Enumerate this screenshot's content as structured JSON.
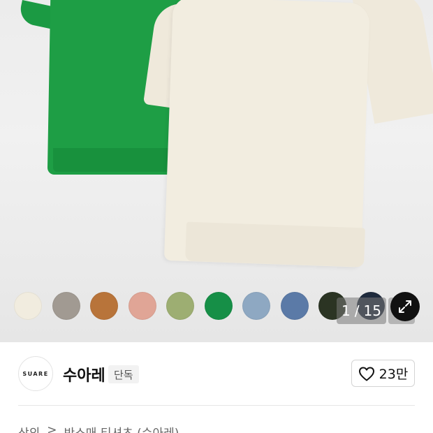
{
  "gallery": {
    "counter": {
      "current": "1",
      "separator": "/",
      "total": "15"
    },
    "swatches": [
      {
        "color": "#f1ecdf"
      },
      {
        "color": "#a19a92"
      },
      {
        "color": "#b8743a"
      },
      {
        "color": "#e0a596"
      },
      {
        "color": "#9dae72"
      },
      {
        "color": "#168f47"
      },
      {
        "color": "#8ea8c2"
      },
      {
        "color": "#5b7aa7"
      },
      {
        "color": "#2b3423"
      },
      {
        "color": "#1f2b3d"
      }
    ],
    "expand_icon": "expand-arrows-icon"
  },
  "brand": {
    "logo_text": "SUARE",
    "name": "수아레",
    "badge": "단독",
    "like_icon": "heart-icon",
    "like_count": "23만"
  },
  "breadcrumb": {
    "items": [
      "상의",
      "반소매 티셔츠 (수아레)"
    ],
    "separator": ">"
  },
  "colors": {
    "green_shirt": "#1e9e45",
    "cream_shirt": "#f2ede0"
  }
}
